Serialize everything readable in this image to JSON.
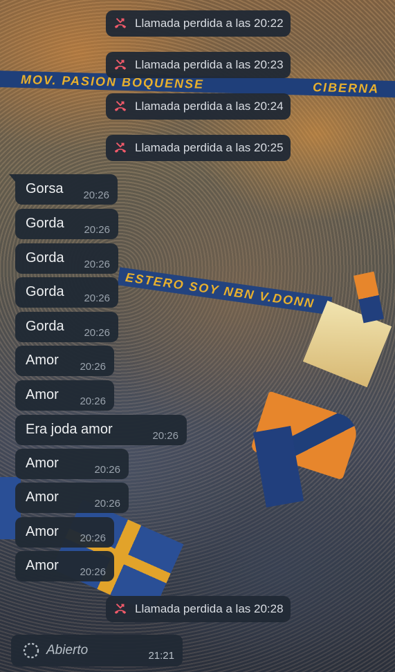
{
  "wallpaper": {
    "banner_top": "MOV. PASION BOQUENSE",
    "banner_top_right": "CIBERNA",
    "banner_mid": "ESTERO SOY  NBN V.DONN"
  },
  "missed_calls_top": [
    {
      "text": "Llamada perdida a las 20:22",
      "icon": "missed-call-icon"
    },
    {
      "text": "Llamada perdida a las 20:23",
      "icon": "missed-call-icon"
    },
    {
      "text": "Llamada perdida a las 20:24",
      "icon": "missed-call-icon"
    },
    {
      "text": "Llamada perdida a las 20:25",
      "icon": "missed-call-icon"
    }
  ],
  "messages": [
    {
      "text": "Gorsa",
      "time": "20:26"
    },
    {
      "text": "Gorda",
      "time": "20:26"
    },
    {
      "text": "Gorda",
      "time": "20:26"
    },
    {
      "text": "Gorda",
      "time": "20:26"
    },
    {
      "text": "Gorda",
      "time": "20:26"
    },
    {
      "text": "Amor",
      "time": "20:26"
    },
    {
      "text": "Amor",
      "time": "20:26"
    },
    {
      "text": "Era joda amor",
      "time": "20:26"
    },
    {
      "text": "Amor",
      "time": "20:26"
    },
    {
      "text": "Amor",
      "time": "20:26"
    },
    {
      "text": "Amor",
      "time": "20:26"
    },
    {
      "text": "Amor",
      "time": "20:26"
    }
  ],
  "missed_call_bottom": {
    "text": "Llamada perdida a las 20:28",
    "icon": "missed-call-icon"
  },
  "status": {
    "text": "Abierto",
    "time": "21:21",
    "icon": "loading-circle-icon"
  },
  "colors": {
    "bubble": "#212a35",
    "missed_call_red": "#f05a6a",
    "text": "#eef0f2",
    "timestamp": "#9aa3ad"
  }
}
